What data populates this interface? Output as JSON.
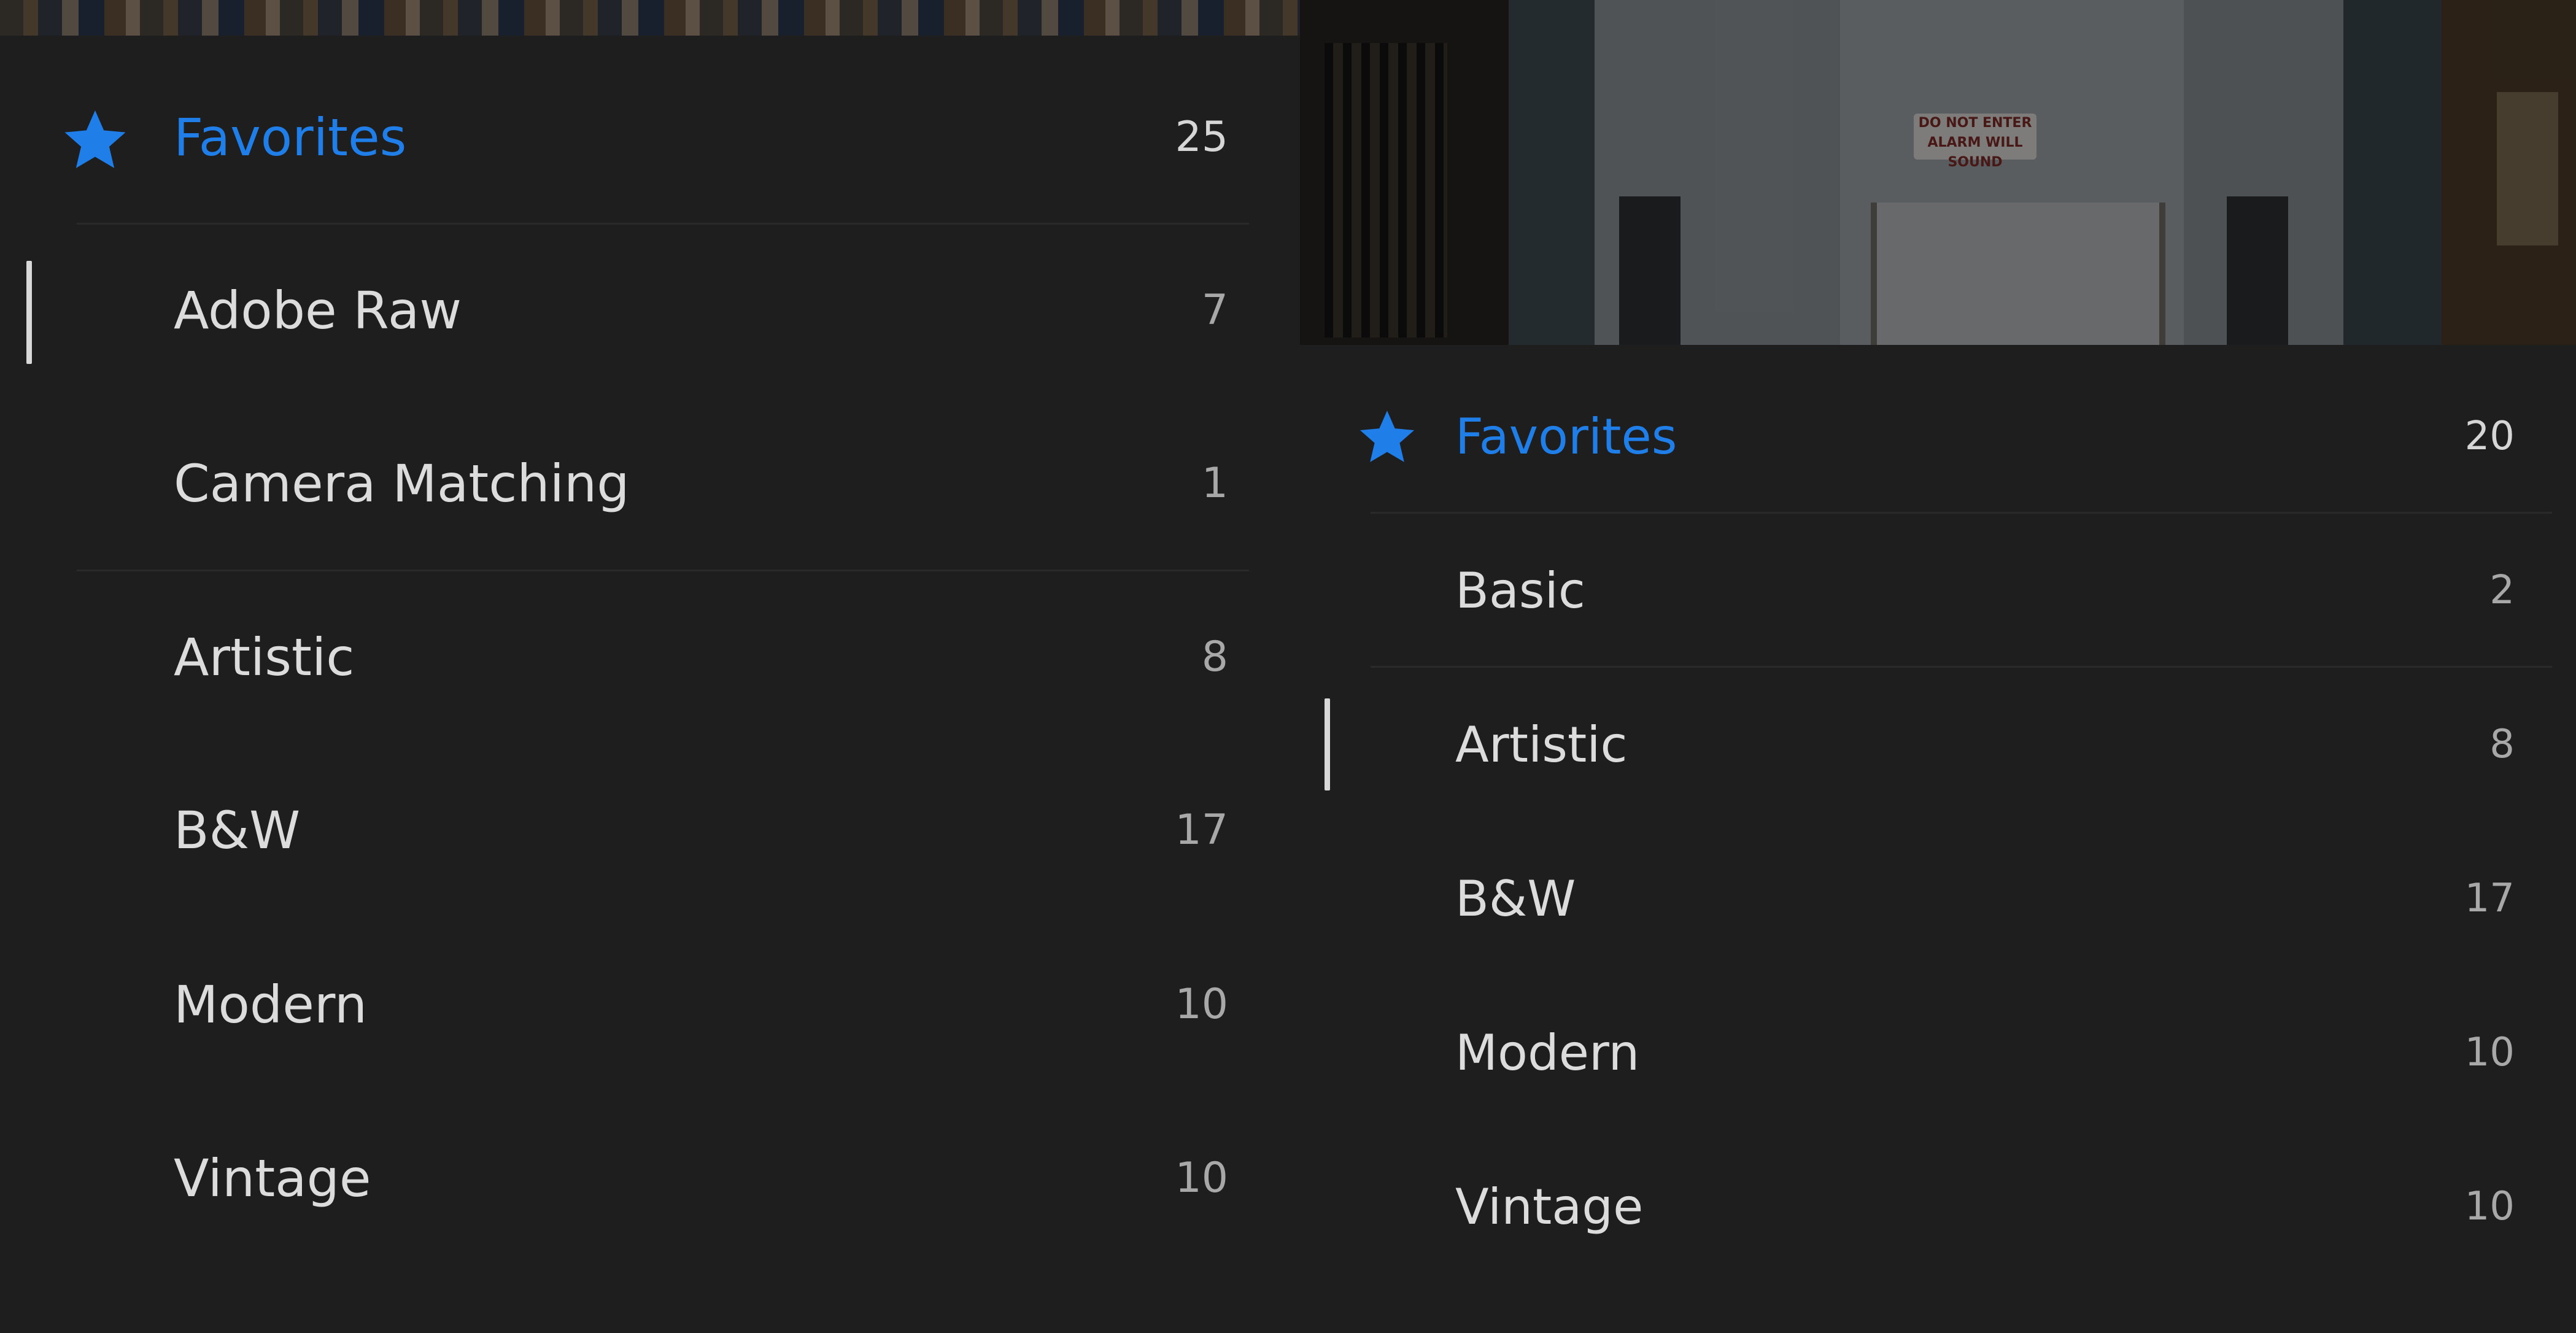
{
  "colors": {
    "background": "#1e1e1e",
    "favorite_accent": "#1f7ee8",
    "label": "#dcdcdc",
    "count": "#a8a8a8"
  },
  "left_panel": {
    "favorites": {
      "label": "Favorites",
      "count": "25",
      "icon": "star-icon"
    },
    "items": [
      {
        "label": "Adobe Raw",
        "count": "7",
        "active": true
      },
      {
        "label": "Camera Matching",
        "count": "1"
      },
      {
        "label": "Artistic",
        "count": "8"
      },
      {
        "label": "B&W",
        "count": "17"
      },
      {
        "label": "Modern",
        "count": "10"
      },
      {
        "label": "Vintage",
        "count": "10"
      }
    ]
  },
  "right_panel": {
    "photo_sign": {
      "line1": "DO NOT ENTER",
      "line2": "ALARM WILL SOUND"
    },
    "favorites": {
      "label": "Favorites",
      "count": "20",
      "icon": "star-icon"
    },
    "items": [
      {
        "label": "Basic",
        "count": "2"
      },
      {
        "label": "Artistic",
        "count": "8",
        "active": true
      },
      {
        "label": "B&W",
        "count": "17"
      },
      {
        "label": "Modern",
        "count": "10"
      },
      {
        "label": "Vintage",
        "count": "10"
      }
    ]
  }
}
